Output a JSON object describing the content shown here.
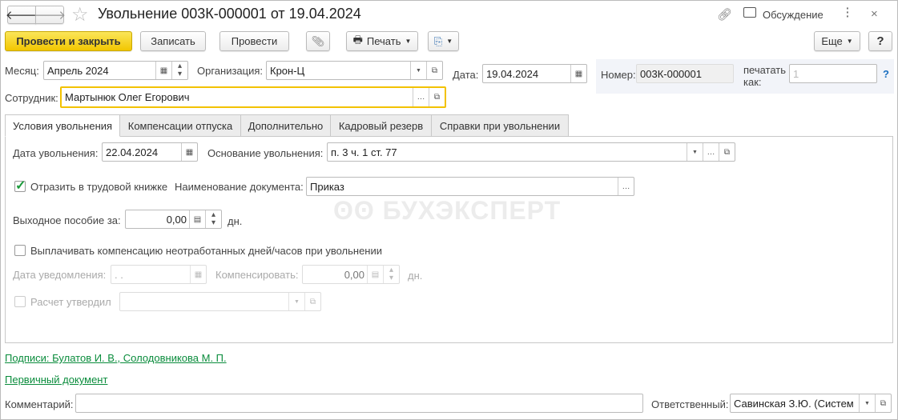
{
  "header": {
    "title": "Увольнение 003К-000001 от 19.04.2024",
    "discussion": "Обсуждение"
  },
  "toolbar": {
    "post_close": "Провести и закрыть",
    "save": "Записать",
    "post": "Провести",
    "print": "Печать",
    "more": "Еще",
    "help": "?"
  },
  "form": {
    "month_label": "Месяц:",
    "month": "Апрель 2024",
    "org_label": "Организация:",
    "org": "Крон-Ц",
    "date_label": "Дата:",
    "date": "19.04.2024",
    "number_label": "Номер:",
    "number": "003К-000001",
    "print_as_label1": "печатать",
    "print_as_label2": "как:",
    "print_as_placeholder": "1",
    "print_as_help": "?",
    "employee_label": "Сотрудник:",
    "employee": "Мартынюк Олег Егорович"
  },
  "tabs": [
    "Условия увольнения",
    "Компенсации отпуска",
    "Дополнительно",
    "Кадровый резерв",
    "Справки при увольнении"
  ],
  "conditions": {
    "dismissal_date_label": "Дата увольнения:",
    "dismissal_date": "22.04.2024",
    "basis_label": "Основание увольнения:",
    "basis": "п. 3 ч. 1 ст. 77",
    "reflect_label": "Отразить в трудовой книжке",
    "reflect_checked": true,
    "doc_name_label": "Наименование документа:",
    "doc_name": "Приказ",
    "severance_label": "Выходное пособие за:",
    "severance": "0,00",
    "days": "дн.",
    "pay_comp_label": "Выплачивать компенсацию неотработанных дней/часов при увольнении",
    "notice_date_label": "Дата уведомления:",
    "notice_date": " .  .",
    "compensate_label": "Компенсировать:",
    "compensate": "0,00",
    "approved_label": "Расчет утвердил",
    "approved": ""
  },
  "watermark": "БУХЭКСПЕРТ",
  "footer": {
    "signatures": "Подписи: Булатов И. В., Солодовникова М. П.",
    "primary_doc": "Первичный документ",
    "comment_label": "Комментарий:",
    "comment": "",
    "responsible_label": "Ответственный:",
    "responsible": "Савинская З.Ю. (Систем"
  },
  "colors": {
    "accent": "#f2c600",
    "link": "#0a8c3c",
    "check": "#1a9a3a"
  }
}
